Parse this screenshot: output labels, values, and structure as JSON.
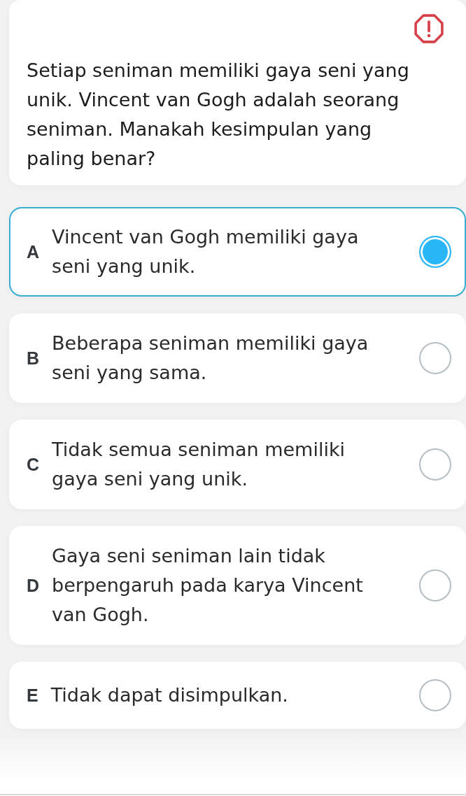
{
  "question": {
    "text": "Setiap seniman memiliki gaya seni yang unik. Vincent van Gogh adalah seorang seniman. Manakah kesimpulan yang paling benar?"
  },
  "options": [
    {
      "letter": "A",
      "text": "Vincent van Gogh memiliki gaya seni yang unik.",
      "selected": true
    },
    {
      "letter": "B",
      "text": "Beberapa seniman memiliki gaya seni yang sama.",
      "selected": false
    },
    {
      "letter": "C",
      "text": "Tidak semua seniman memiliki gaya seni yang unik.",
      "selected": false
    },
    {
      "letter": "D",
      "text": "Gaya seni seniman lain tidak berpengaruh pada karya Vincent van Gogh.",
      "selected": false
    },
    {
      "letter": "E",
      "text": "Tidak dapat disimpulkan.",
      "selected": false
    }
  ]
}
